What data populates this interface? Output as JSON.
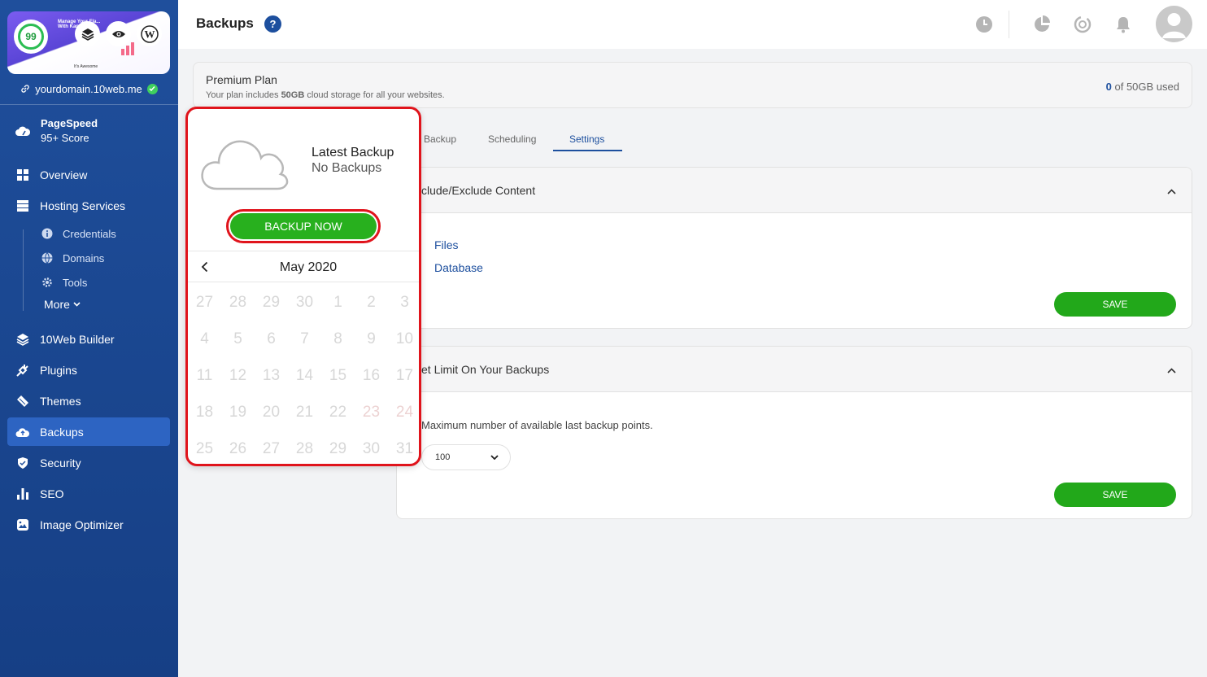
{
  "sidebar": {
    "site": {
      "thumb_headline": "Manage Your Fla... With Kangouro...",
      "thumb_caption": "It's Awesome",
      "score": "99",
      "domain": "yourdomain.10web.me"
    },
    "pagespeed": {
      "title": "PageSpeed",
      "subtitle": "95+ Score"
    },
    "nav": {
      "overview": "Overview",
      "hosting": "Hosting Services",
      "credentials": "Credentials",
      "domains": "Domains",
      "tools": "Tools",
      "more": "More",
      "builder": "10Web Builder",
      "plugins": "Plugins",
      "themes": "Themes",
      "backups": "Backups",
      "security": "Security",
      "seo": "SEO",
      "image_optimizer": "Image Optimizer"
    }
  },
  "header": {
    "title": "Backups",
    "help": "?"
  },
  "plan": {
    "name": "Premium Plan",
    "desc_prefix": "Your plan includes ",
    "desc_bold": "50GB",
    "desc_suffix": " cloud storage for all your websites.",
    "used_value": "0",
    "used_suffix": " of 50GB used"
  },
  "tabs": {
    "backup": "Backup",
    "scheduling": "Scheduling",
    "settings": "Settings"
  },
  "include_panel": {
    "title": "clude/Exclude Content",
    "items": [
      "Files",
      "Database"
    ],
    "save": "SAVE"
  },
  "limit_panel": {
    "title": "et Limit On Your Backups",
    "text": "Maximum number of available last backup points.",
    "select_value": "100",
    "save": "SAVE"
  },
  "popup": {
    "title": "Latest Backup",
    "subtitle": "No Backups",
    "button": "BACKUP NOW",
    "month": "May 2020",
    "weeks": [
      [
        "27",
        "28",
        "29",
        "30",
        "1",
        "2",
        "3"
      ],
      [
        "4",
        "5",
        "6",
        "7",
        "8",
        "9",
        "10"
      ],
      [
        "11",
        "12",
        "13",
        "14",
        "15",
        "16",
        "17"
      ],
      [
        "18",
        "19",
        "20",
        "21",
        "22",
        "23",
        "24"
      ],
      [
        "25",
        "26",
        "27",
        "28",
        "29",
        "30",
        "31"
      ]
    ]
  },
  "colors": {
    "sidebar": "#1f4f9c",
    "active_nav": "#2d64c2",
    "accent": "#1d4f9e",
    "save_green": "#22a81a",
    "highlight_red": "#e0141c"
  }
}
